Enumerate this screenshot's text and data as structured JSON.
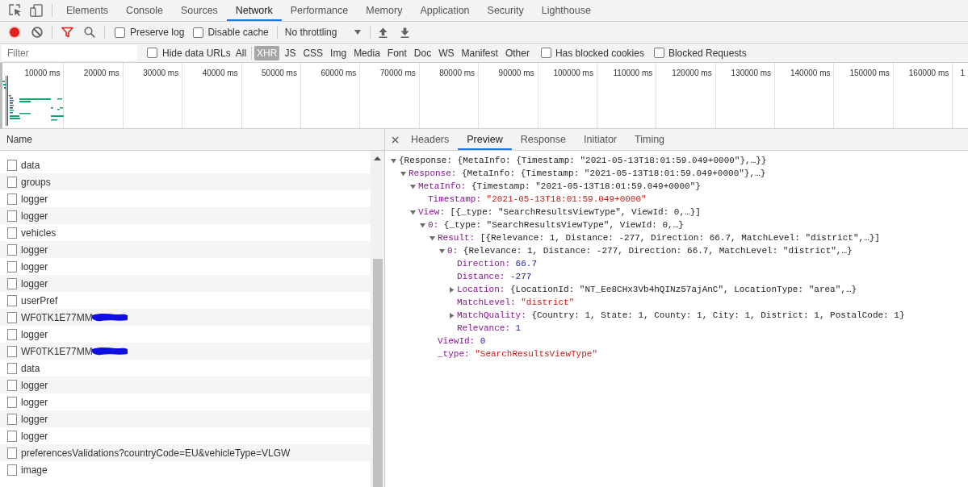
{
  "panels": [
    {
      "label": "Elements",
      "selected": false
    },
    {
      "label": "Console",
      "selected": false
    },
    {
      "label": "Sources",
      "selected": false
    },
    {
      "label": "Network",
      "selected": true
    },
    {
      "label": "Performance",
      "selected": false
    },
    {
      "label": "Memory",
      "selected": false
    },
    {
      "label": "Application",
      "selected": false
    },
    {
      "label": "Security",
      "selected": false
    },
    {
      "label": "Lighthouse",
      "selected": false
    }
  ],
  "network_toolbar": {
    "recording": true,
    "preserve_log": {
      "label": "Preserve log",
      "checked": false
    },
    "disable_cache": {
      "label": "Disable cache",
      "checked": false
    },
    "throttling": "No throttling"
  },
  "filter_bar": {
    "placeholder": "Filter",
    "hide_data_urls": {
      "label": "Hide data URLs",
      "checked": false
    },
    "types": [
      {
        "label": "All",
        "selected": false
      },
      {
        "label": "XHR",
        "selected": true
      },
      {
        "label": "JS",
        "selected": false
      },
      {
        "label": "CSS",
        "selected": false
      },
      {
        "label": "Img",
        "selected": false
      },
      {
        "label": "Media",
        "selected": false
      },
      {
        "label": "Font",
        "selected": false
      },
      {
        "label": "Doc",
        "selected": false
      },
      {
        "label": "WS",
        "selected": false
      },
      {
        "label": "Manifest",
        "selected": false
      },
      {
        "label": "Other",
        "selected": false
      }
    ],
    "options": [
      {
        "label": "Has blocked cookies",
        "checked": false
      },
      {
        "label": "Blocked Requests",
        "checked": false
      }
    ]
  },
  "timeline": {
    "ticks": [
      "10000 ms",
      "20000 ms",
      "30000 ms",
      "40000 ms",
      "50000 ms",
      "60000 ms",
      "70000 ms",
      "80000 ms",
      "90000 ms",
      "100000 ms",
      "110000 ms",
      "120000 ms",
      "130000 ms",
      "140000 ms",
      "150000 ms",
      "160000 ms",
      "1"
    ]
  },
  "requests": {
    "column": "Name",
    "rows": [
      {
        "name": "data",
        "redacted": false
      },
      {
        "name": "groups",
        "redacted": false
      },
      {
        "name": "logger",
        "redacted": false
      },
      {
        "name": "logger",
        "redacted": false
      },
      {
        "name": "vehicles",
        "redacted": false
      },
      {
        "name": "logger",
        "redacted": false
      },
      {
        "name": "logger",
        "redacted": false
      },
      {
        "name": "logger",
        "redacted": false
      },
      {
        "name": "userPref",
        "redacted": false
      },
      {
        "name": "WF0TK1E77MM",
        "redacted": true
      },
      {
        "name": "logger",
        "redacted": false
      },
      {
        "name": "WF0TK1E77MM",
        "redacted": true
      },
      {
        "name": "data",
        "redacted": false
      },
      {
        "name": "logger",
        "redacted": false
      },
      {
        "name": "logger",
        "redacted": false
      },
      {
        "name": "logger",
        "redacted": false
      },
      {
        "name": "logger",
        "redacted": false
      },
      {
        "name": "preferencesValidations?countryCode=EU&vehicleType=VLGW",
        "redacted": false
      },
      {
        "name": "image",
        "redacted": false
      }
    ]
  },
  "details": {
    "tabs": [
      {
        "label": "Headers",
        "selected": false
      },
      {
        "label": "Preview",
        "selected": true
      },
      {
        "label": "Response",
        "selected": false
      },
      {
        "label": "Initiator",
        "selected": false
      },
      {
        "label": "Timing",
        "selected": false
      }
    ],
    "preview": {
      "value": "{Response: {MetaInfo: {Timestamp: \"2021-05-13T18:01:59.049+0000\"},…}}",
      "kind": "object",
      "expanded": true,
      "children": [
        {
          "key": "Response:",
          "value": "{MetaInfo: {Timestamp: \"2021-05-13T18:01:59.049+0000\"},…}",
          "kind": "object",
          "expanded": true,
          "children": [
            {
              "key": "MetaInfo:",
              "value": "{Timestamp: \"2021-05-13T18:01:59.049+0000\"}",
              "kind": "object",
              "expanded": true,
              "children": [
                {
                  "key": "Timestamp:",
                  "value": "\"2021-05-13T18:01:59.049+0000\"",
                  "kind": "string"
                }
              ]
            },
            {
              "key": "View:",
              "value": "[{_type: \"SearchResultsViewType\", ViewId: 0,…}]",
              "kind": "object",
              "expanded": true,
              "children": [
                {
                  "key": "0:",
                  "value": "{_type: \"SearchResultsViewType\", ViewId: 0,…}",
                  "kind": "object",
                  "expanded": true,
                  "children": [
                    {
                      "key": "Result:",
                      "value": "[{Relevance: 1, Distance: -277, Direction: 66.7, MatchLevel: \"district\",…}]",
                      "kind": "object",
                      "expanded": true,
                      "children": [
                        {
                          "key": "0:",
                          "value": "{Relevance: 1, Distance: -277, Direction: 66.7, MatchLevel: \"district\",…}",
                          "kind": "object",
                          "expanded": true,
                          "children": [
                            {
                              "key": "Direction:",
                              "value": "66.7",
                              "kind": "number"
                            },
                            {
                              "key": "Distance:",
                              "value": "-277",
                              "kind": "number"
                            },
                            {
                              "key": "Location:",
                              "value": "{LocationId: \"NT_Ee8CHx3Vb4hQINz57ajAnC\", LocationType: \"area\",…}",
                              "kind": "object",
                              "expanded": false
                            },
                            {
                              "key": "MatchLevel:",
                              "value": "\"district\"",
                              "kind": "string"
                            },
                            {
                              "key": "MatchQuality:",
                              "value": "{Country: 1, State: 1, County: 1, City: 1, District: 1, PostalCode: 1}",
                              "kind": "object",
                              "expanded": false
                            },
                            {
                              "key": "Relevance:",
                              "value": "1",
                              "kind": "number"
                            }
                          ]
                        }
                      ]
                    },
                    {
                      "key": "ViewId:",
                      "value": "0",
                      "kind": "number"
                    },
                    {
                      "key": "_type:",
                      "value": "\"SearchResultsViewType\"",
                      "kind": "string"
                    }
                  ]
                }
              ]
            }
          ]
        }
      ]
    }
  }
}
